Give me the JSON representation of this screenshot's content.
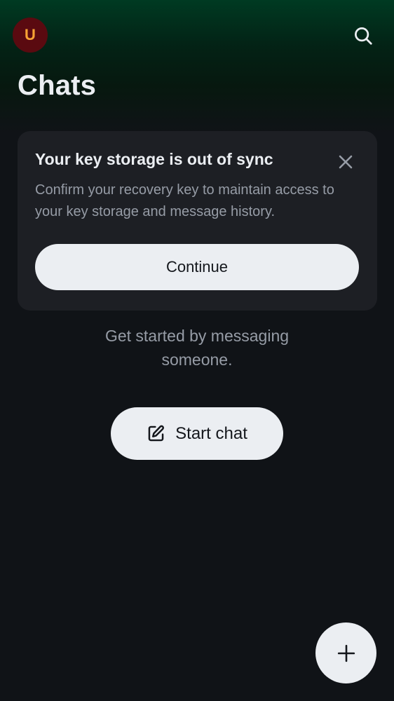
{
  "header": {
    "avatar_initial": "U",
    "title": "Chats",
    "search_icon": "search-icon"
  },
  "banner": {
    "title": "Your key storage is out of sync",
    "description": "Confirm your recovery key to maintain access to your key storage and message history.",
    "continue_label": "Continue",
    "close_icon": "close-icon"
  },
  "empty_state": {
    "line1": "Get started by messaging",
    "line2": "someone.",
    "start_chat_label": "Start chat",
    "start_chat_icon": "edit-icon"
  },
  "fab": {
    "icon": "plus-icon"
  },
  "colors": {
    "background": "#101317",
    "header_gradient_top": "#003a22",
    "avatar_bg": "#5a0a10",
    "avatar_text": "#f7a234",
    "card_bg": "#1d1f24",
    "button_bg": "#ebeef2",
    "muted_text": "#969ca6"
  }
}
